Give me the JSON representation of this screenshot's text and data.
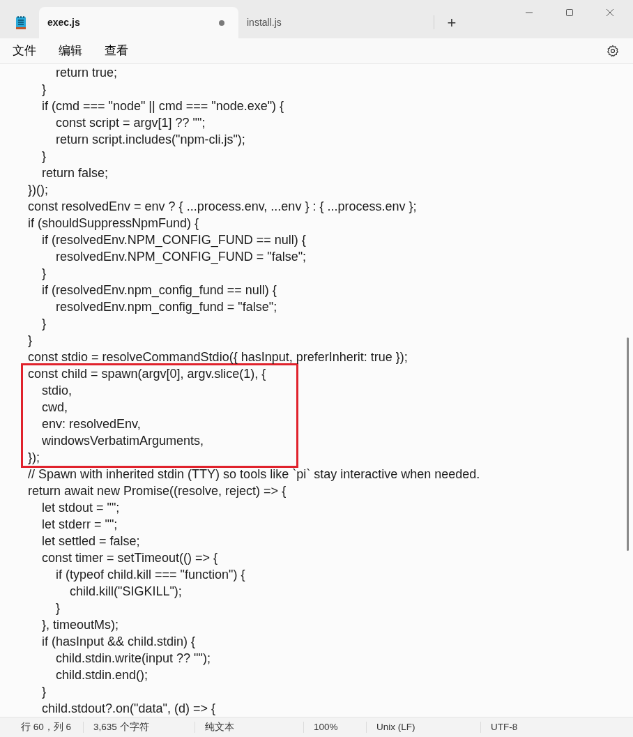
{
  "window": {
    "tabs": [
      {
        "label": "exec.js",
        "selected": true,
        "modified": true
      },
      {
        "label": "install.js",
        "selected": false,
        "modified": false
      }
    ],
    "new_tab": "+"
  },
  "menu": [
    "文件",
    "编辑",
    "查看"
  ],
  "code": [
    {
      "boxed": false,
      "lines": [
        "        return true;",
        "    }",
        "    if (cmd === \"node\" || cmd === \"node.exe\") {",
        "        const script = argv[1] ?? \"\";",
        "        return script.includes(\"npm-cli.js\");",
        "    }",
        "    return false;",
        "})();",
        "const resolvedEnv = env ? { ...process.env, ...env } : { ...process.env };",
        "if (shouldSuppressNpmFund) {",
        "    if (resolvedEnv.NPM_CONFIG_FUND == null) {",
        "        resolvedEnv.NPM_CONFIG_FUND = \"false\";",
        "    }",
        "    if (resolvedEnv.npm_config_fund == null) {",
        "        resolvedEnv.npm_config_fund = \"false\";",
        "    }",
        "}",
        "const stdio = resolveCommandStdio({ hasInput, preferInherit: true });"
      ]
    },
    {
      "boxed": true,
      "lines": [
        "const child = spawn(argv[0], argv.slice(1), {",
        "    stdio,",
        "    cwd,",
        "    env: resolvedEnv,",
        "    windowsVerbatimArguments,",
        "});"
      ]
    },
    {
      "boxed": false,
      "lines": [
        "// Spawn with inherited stdin (TTY) so tools like `pi` stay interactive when needed.",
        "return await new Promise((resolve, reject) => {",
        "    let stdout = \"\";",
        "    let stderr = \"\";",
        "    let settled = false;",
        "    const timer = setTimeout(() => {",
        "        if (typeof child.kill === \"function\") {",
        "            child.kill(\"SIGKILL\");",
        "        }",
        "    }, timeoutMs);",
        "    if (hasInput && child.stdin) {",
        "        child.stdin.write(input ?? \"\");",
        "        child.stdin.end();",
        "    }",
        "    child.stdout?.on(\"data\", (d) => {"
      ]
    }
  ],
  "status_bar": [
    "行 60，列 6",
    "3,635 个字符",
    "纯文本",
    "100%",
    "Unix (LF)",
    "UTF-8"
  ]
}
